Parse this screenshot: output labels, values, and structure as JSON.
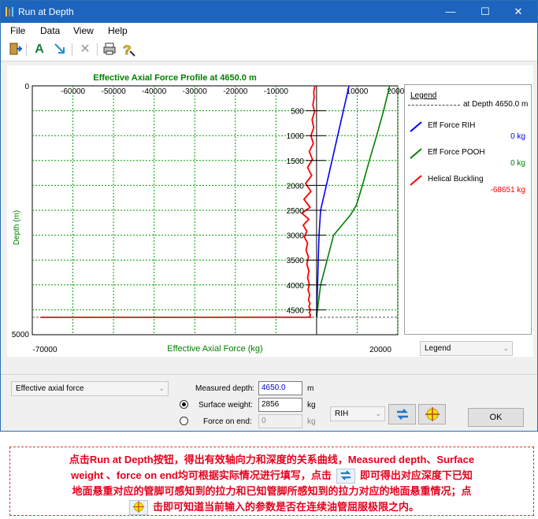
{
  "window": {
    "title": "Run at Depth"
  },
  "menu": [
    "File",
    "Data",
    "View",
    "Help"
  ],
  "chart_data": {
    "type": "line",
    "title": "Effective Axial Force Profile at 4650.0 m",
    "xlabel": "Effective Axial Force (kg)",
    "ylabel": "Depth (m)",
    "xlim": [
      -70000,
      20000
    ],
    "ylim": [
      0,
      5000
    ],
    "y_inverted": true,
    "x_ticks": [
      -60000,
      -50000,
      -40000,
      -30000,
      -20000,
      -10000,
      10000,
      20000
    ],
    "x_tick_labels": [
      "-60000",
      "-50000",
      "-40000",
      "-30000",
      "-20000",
      "-10000",
      "10000",
      "20000"
    ],
    "x_end_labels": [
      "-70000",
      "20000"
    ],
    "y_ticks": [
      500,
      1000,
      1500,
      2000,
      2500,
      3000,
      3500,
      4000,
      4500
    ],
    "y_tick_labels": [
      "500",
      "1000",
      "1500",
      "2000",
      "2500",
      "3000",
      "3500",
      "4000",
      "4500"
    ],
    "y_end_labels": [
      "0",
      "5000"
    ],
    "grid": true,
    "series": [
      {
        "name": "Eff Force RIH",
        "color": "#0000ff",
        "x": [
          8000,
          6600,
          5200,
          3800,
          2400,
          1000,
          600,
          400,
          250,
          120,
          0
        ],
        "y": [
          0,
          500,
          1000,
          1500,
          2000,
          2500,
          3000,
          3500,
          4000,
          4300,
          4650
        ]
      },
      {
        "name": "Eff Force POOH",
        "color": "#008000",
        "x": [
          18000,
          16500,
          14800,
          13000,
          11300,
          9800,
          8300,
          4200,
          2600,
          1000,
          0
        ],
        "y": [
          0,
          500,
          1000,
          1500,
          2000,
          2400,
          2600,
          3000,
          3500,
          4000,
          4650
        ]
      },
      {
        "name": "Helical Buckling",
        "color": "#ff0000",
        "x": [
          -400,
          -700,
          -600,
          -900,
          -500,
          -1100,
          -700,
          -1400,
          -800,
          -1800,
          -1000,
          -2200,
          -1200,
          -2700,
          -1400,
          -3100,
          -1600,
          -3600,
          -1900,
          -3300,
          -2400,
          -3000,
          -2200,
          -2600,
          -2000,
          -2400,
          -1900,
          -2200,
          -1800,
          -2100,
          -1700,
          -2000,
          -1600,
          -1900,
          -1500,
          -1800,
          -1500,
          -1700,
          -1500,
          -68000
        ],
        "y": [
          0,
          120,
          240,
          380,
          520,
          680,
          840,
          1000,
          1160,
          1320,
          1480,
          1640,
          1800,
          1960,
          2120,
          2280,
          2440,
          2560,
          2680,
          2800,
          2920,
          3040,
          3160,
          3300,
          3440,
          3580,
          3720,
          3860,
          3980,
          4100,
          4200,
          4300,
          4380,
          4440,
          4500,
          4560,
          4600,
          4630,
          4648,
          4650
        ]
      }
    ]
  },
  "legend": {
    "title": "Legend",
    "depth_label": "at Depth 4650.0 m",
    "items": [
      {
        "name": "Eff Force RIH",
        "value": "0 kg",
        "color": "#0000ff",
        "value_color": "#0000ff"
      },
      {
        "name": "Eff Force POOH",
        "value": "0 kg",
        "color": "#008000",
        "value_color": "#008000"
      },
      {
        "name": "Helical Buckling",
        "value": "-68651 kg",
        "color": "#ff0000",
        "value_color": "#ff0000"
      }
    ]
  },
  "legend_select": {
    "value": "Legend"
  },
  "plot_select": {
    "value": "Effective axial force"
  },
  "form": {
    "measured_depth_label": "Measured depth:",
    "measured_depth_value": "4650.0",
    "measured_depth_unit": "m",
    "surface_weight_label": "Surface weight:",
    "surface_weight_value": "2856",
    "surface_weight_unit": "kg",
    "force_on_end_label": "Force on end:",
    "force_on_end_value": "0",
    "force_on_end_unit": "kg"
  },
  "mode_select": {
    "value": "RIH"
  },
  "ok_button": {
    "label": "OK"
  },
  "note": {
    "line1": "点击Run at Depth按钮，得出有效轴向力和深度的关系曲线，Measured depth、Surface",
    "line2a": "weight 、force on end均可根据实际情况进行填写，点击",
    "line2b": "即可得出对应深度下已知",
    "line3": "地面悬重对应的管脚可感知到的拉力和已知管脚所感知到的拉力对应的地面悬重情况；点",
    "line4": "击即可知道当前输入的参数是否在连续油管屈服极限之内。"
  }
}
